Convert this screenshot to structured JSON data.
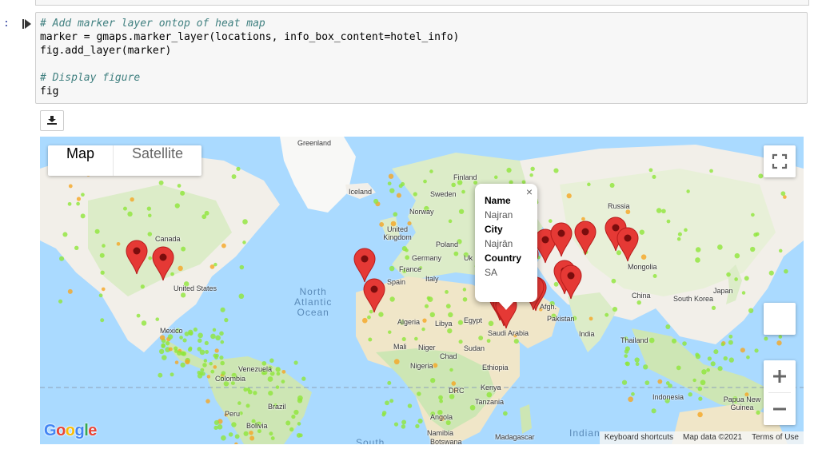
{
  "cell": {
    "prompt": ":",
    "code_lines": [
      {
        "type": "comment",
        "text": "# Add marker layer ontop of heat map"
      },
      {
        "type": "code",
        "text": "marker = gmaps.marker_layer(locations, info_box_content=hotel_info)"
      },
      {
        "type": "code",
        "text": "fig.add_layer(marker)"
      },
      {
        "type": "blank",
        "text": ""
      },
      {
        "type": "comment",
        "text": "# Display figure"
      },
      {
        "type": "code",
        "text": "fig"
      }
    ]
  },
  "download_icon": "download-icon",
  "map": {
    "maptype": {
      "map_label": "Map",
      "satellite_label": "Satellite",
      "selected": "Map"
    },
    "fullscreen_icon": "fullscreen-icon",
    "zoom": {
      "in": "+",
      "out": "−"
    },
    "info_window": {
      "close": "×",
      "fields": [
        {
          "label": "Name",
          "value": "Najran"
        },
        {
          "label": "City",
          "value": "Najrān"
        },
        {
          "label": "Country",
          "value": "SA"
        }
      ]
    },
    "country_labels": [
      "Greenland",
      "Finland",
      "Iceland",
      "Sweden",
      "Norway",
      "Russia",
      "United Kingdom",
      "Poland",
      "Germany",
      "France",
      "Italy",
      "Spain",
      "Uk",
      "Canada",
      "United States",
      "Mexico",
      "Algeria",
      "Libya",
      "Egypt",
      "Mali",
      "Niger",
      "Chad",
      "Sudan",
      "Nigeria",
      "Ethiopia",
      "Kenya",
      "DRC",
      "Tanzania",
      "Angola",
      "Namibia",
      "Botswana",
      "Madagascar",
      "Saudi Arabia",
      "Afgh.",
      "Pakistan",
      "India",
      "China",
      "Mongolia",
      "Japan",
      "South Korea",
      "Thailand",
      "Indonesia",
      "Papua New Guinea",
      "Venezuela",
      "Colombia",
      "Peru",
      "Brazil",
      "Bolivia"
    ],
    "ocean_labels": [
      "North\nAtlantic\nOcean",
      "Indian",
      "South"
    ],
    "attribution": {
      "shortcuts": "Keyboard shortcuts",
      "data": "Map data ©2021",
      "terms": "Terms of Use"
    },
    "logo": "Google",
    "colors": {
      "water": "#aadaff",
      "land": "#f2efe9",
      "desert": "#f0e6c8",
      "vegetation": "#cde6b4",
      "marker": "#e53935",
      "heat": "#8ee63a"
    }
  }
}
